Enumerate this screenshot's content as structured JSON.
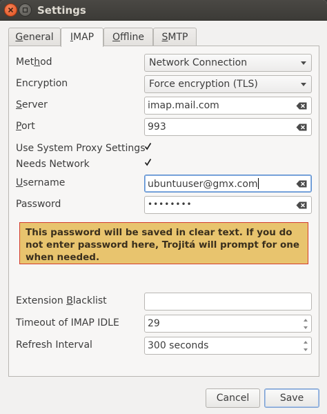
{
  "window": {
    "title": "Settings"
  },
  "tabs": [
    {
      "label": "General",
      "mnemonic": "G"
    },
    {
      "label": "IMAP",
      "mnemonic": "I",
      "active": true
    },
    {
      "label": "Offline",
      "mnemonic": "O"
    },
    {
      "label": "SMTP",
      "mnemonic": "S"
    }
  ],
  "form": {
    "method": {
      "label": "Method",
      "mnemonic": "h",
      "value": "Network Connection"
    },
    "encryption": {
      "label": "Encryption",
      "value": "Force encryption (TLS)"
    },
    "server": {
      "label": "Server",
      "mnemonic": "S",
      "value": "imap.mail.com"
    },
    "port": {
      "label": "Port",
      "mnemonic": "P",
      "value": "993"
    },
    "use_proxy": {
      "label": "Use System Proxy Settings",
      "checked": true
    },
    "needs_network": {
      "label": "Needs Network",
      "checked": true
    },
    "username": {
      "label": "Username",
      "mnemonic": "U",
      "value": "ubuntuuser@gmx.com"
    },
    "password": {
      "label": "Password",
      "value": "••••••••"
    },
    "warning": "This password will be saved in clear text. If you do not enter password here, Trojitá will prompt for one when needed.",
    "extension_blacklist": {
      "label": "Extension Blacklist",
      "mnemonic": "B",
      "value": ""
    },
    "timeout_idle": {
      "label": "Timeout of IMAP IDLE",
      "value": "29"
    },
    "refresh_interval": {
      "label": "Refresh Interval",
      "value": "300 seconds"
    }
  },
  "buttons": {
    "cancel": "Cancel",
    "save": "Save"
  },
  "colors": {
    "warning_bg": "#e8c46e",
    "warning_border": "#d33b2e",
    "focus": "#5a8fd0"
  }
}
